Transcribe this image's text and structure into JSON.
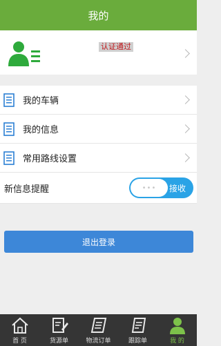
{
  "header": {
    "title": "我的"
  },
  "profile": {
    "badge": "认证通过",
    "avatar_icon": "user-icon"
  },
  "menu": {
    "items": [
      {
        "label": "我的车辆",
        "icon": "document-icon"
      },
      {
        "label": "我的信息",
        "icon": "document-icon"
      },
      {
        "label": "常用路线设置",
        "icon": "document-icon"
      }
    ]
  },
  "notification": {
    "label": "新信息提醒",
    "toggle_text": "接收",
    "knob_text": "•••",
    "enabled": true
  },
  "logout": {
    "label": "退出登录"
  },
  "tabbar": {
    "tabs": [
      {
        "label": "首 页",
        "icon": "home-icon"
      },
      {
        "label": "货源单",
        "icon": "edit-doc-icon"
      },
      {
        "label": "物流订单",
        "icon": "list-doc-icon"
      },
      {
        "label": "跟踪单",
        "icon": "track-doc-icon"
      },
      {
        "label": "我 的",
        "icon": "user-icon"
      }
    ],
    "active": "我 的"
  },
  "colors": {
    "header": "#6aac3c",
    "accent_blue": "#2aa3e6",
    "button_blue": "#3d87d8",
    "badge_red": "#c0161a"
  }
}
